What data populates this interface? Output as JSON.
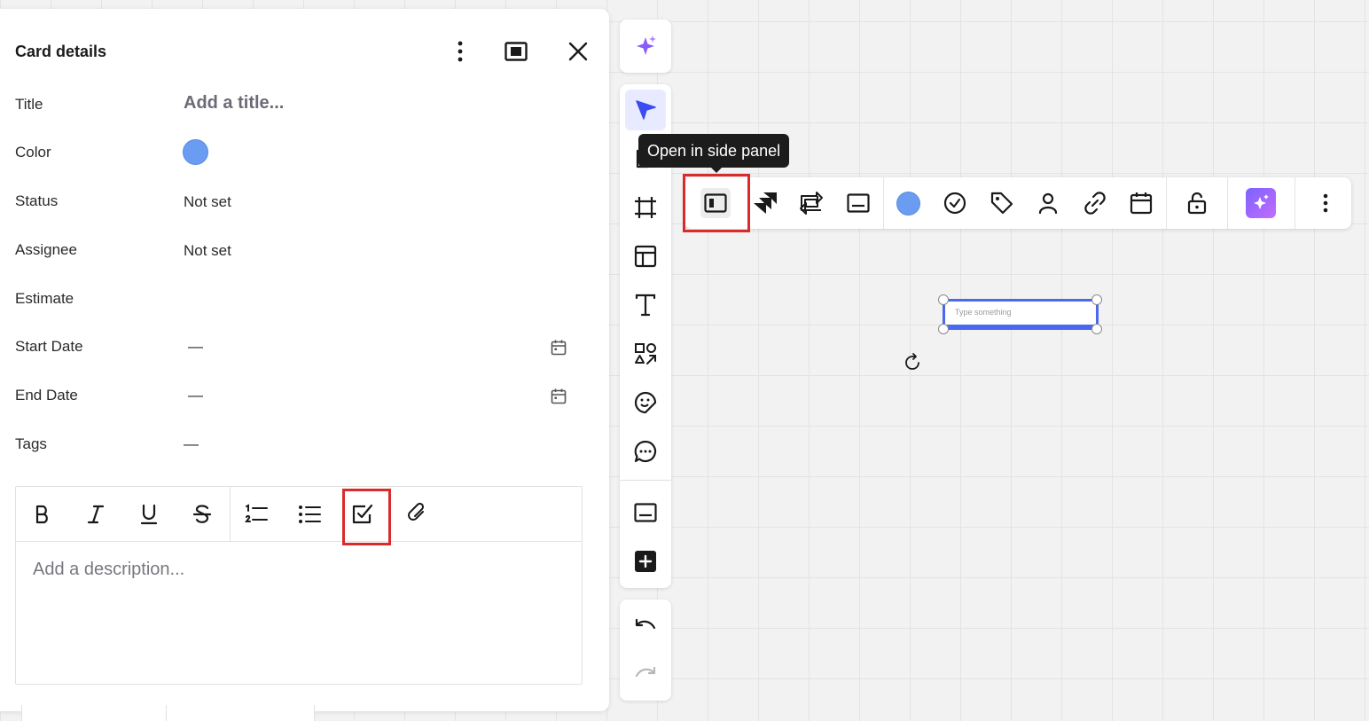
{
  "panel": {
    "title": "Card details",
    "fields": [
      {
        "label": "Title",
        "value": "Add a title..."
      },
      {
        "label": "Color",
        "value": ""
      },
      {
        "label": "Status",
        "value": "Not set"
      },
      {
        "label": "Assignee",
        "value": "Not set"
      },
      {
        "label": "Estimate",
        "value": ""
      },
      {
        "label": "Start Date",
        "value": "—"
      },
      {
        "label": "End Date",
        "value": "—"
      },
      {
        "label": "Tags",
        "value": "—"
      }
    ],
    "card_color": "#6a9cf2",
    "description_placeholder": "Add a description..."
  },
  "editor_toolbar": {
    "buttons": [
      "bold-icon",
      "italic-icon",
      "underline-icon",
      "strikethrough-icon",
      "numbered-list-icon",
      "bullet-list-icon",
      "checklist-icon",
      "link-icon"
    ]
  },
  "left_toolbar": {
    "tools": [
      "ai-sparkle-icon",
      "select-cursor-icon",
      "sticky-note-icon",
      "frame-icon",
      "templates-icon",
      "text-icon",
      "shapes-icon",
      "sticker-icon",
      "comment-icon",
      "card-icon",
      "add-icon",
      "undo-icon",
      "redo-icon"
    ]
  },
  "context_toolbar": {
    "tooltip": "Open in side panel",
    "buttons": [
      "side-panel-icon",
      "jira-icon",
      "convert-icon",
      "card-icon",
      "color-dot",
      "status-check-icon",
      "tag-icon",
      "assignee-icon",
      "link-icon",
      "calendar-icon",
      "unlock-icon",
      "ai-icon",
      "more-icon"
    ]
  },
  "canvas": {
    "card_placeholder": "Type something"
  },
  "colors": {
    "accent": "#4a68f0",
    "highlight_box": "#d92b2b",
    "ai_gradient": "#7b63ff"
  }
}
